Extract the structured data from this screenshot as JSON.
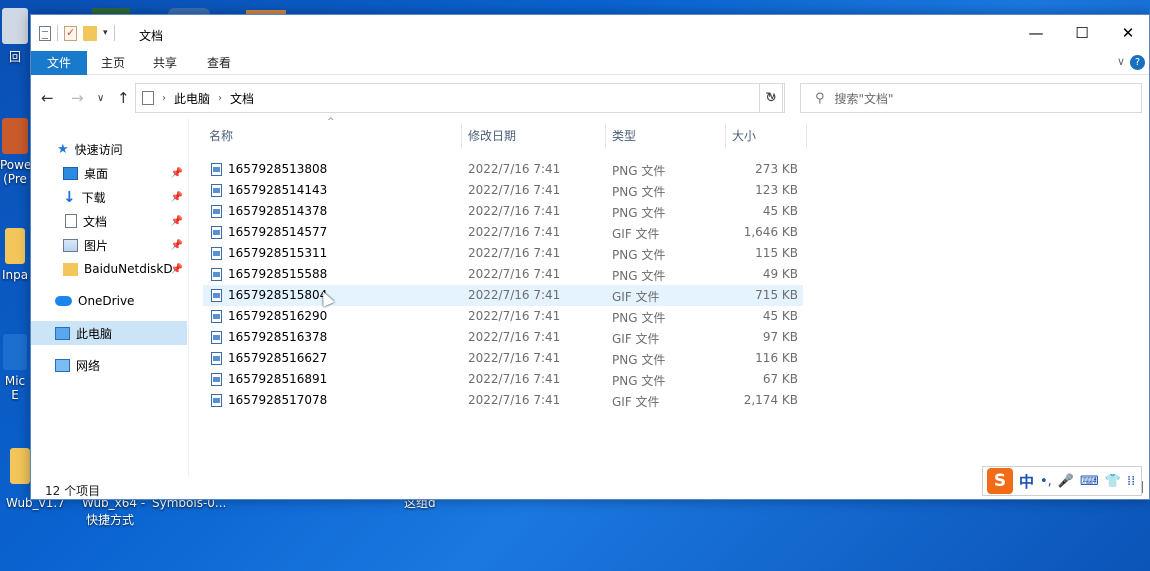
{
  "window": {
    "title": "文档",
    "minimize": "—",
    "maximize": "☐",
    "close": "✕"
  },
  "ribbon": {
    "tabs": [
      "文件",
      "主页",
      "共享",
      "查看"
    ],
    "chevron": "∨",
    "help": "?"
  },
  "nav": {
    "back": "←",
    "forward": "→",
    "recent": "∨",
    "up": "↑",
    "breadcrumb": [
      "此电脑",
      "文档"
    ],
    "breadcrumb_sep": "›",
    "refresh": "↻",
    "search_placeholder": "搜索\"文档\""
  },
  "sidebar": {
    "items": [
      {
        "label": "快速访问",
        "icon": "star-icon"
      },
      {
        "label": "桌面",
        "icon": "desktop-icon",
        "pinned": true
      },
      {
        "label": "下载",
        "icon": "download-icon",
        "pinned": true
      },
      {
        "label": "文档",
        "icon": "document-icon",
        "pinned": true
      },
      {
        "label": "图片",
        "icon": "pictures-icon",
        "pinned": true
      },
      {
        "label": "BaiduNetdiskD",
        "icon": "folder-icon",
        "pinned": true
      },
      {
        "label": "OneDrive",
        "icon": "cloud-icon"
      },
      {
        "label": "此电脑",
        "icon": "computer-icon",
        "selected": true
      },
      {
        "label": "网络",
        "icon": "network-icon"
      }
    ]
  },
  "columns": {
    "name": "名称",
    "date": "修改日期",
    "type": "类型",
    "size": "大小"
  },
  "files": [
    {
      "name": "1657928513808",
      "date": "2022/7/16 7:41",
      "type": "PNG 文件",
      "size": "273 KB"
    },
    {
      "name": "1657928514143",
      "date": "2022/7/16 7:41",
      "type": "PNG 文件",
      "size": "123 KB"
    },
    {
      "name": "1657928514378",
      "date": "2022/7/16 7:41",
      "type": "PNG 文件",
      "size": "45 KB"
    },
    {
      "name": "1657928514577",
      "date": "2022/7/16 7:41",
      "type": "GIF 文件",
      "size": "1,646 KB"
    },
    {
      "name": "1657928515311",
      "date": "2022/7/16 7:41",
      "type": "PNG 文件",
      "size": "115 KB"
    },
    {
      "name": "1657928515588",
      "date": "2022/7/16 7:41",
      "type": "PNG 文件",
      "size": "49 KB"
    },
    {
      "name": "1657928515804",
      "date": "2022/7/16 7:41",
      "type": "GIF 文件",
      "size": "715 KB",
      "hover": true
    },
    {
      "name": "1657928516290",
      "date": "2022/7/16 7:41",
      "type": "PNG 文件",
      "size": "45 KB"
    },
    {
      "name": "1657928516378",
      "date": "2022/7/16 7:41",
      "type": "GIF 文件",
      "size": "97 KB"
    },
    {
      "name": "1657928516627",
      "date": "2022/7/16 7:41",
      "type": "PNG 文件",
      "size": "116 KB"
    },
    {
      "name": "1657928516891",
      "date": "2022/7/16 7:41",
      "type": "PNG 文件",
      "size": "67 KB"
    },
    {
      "name": "1657928517078",
      "date": "2022/7/16 7:41",
      "type": "GIF 文件",
      "size": "2,174 KB"
    }
  ],
  "status": {
    "count": "12 个项目"
  },
  "ime": {
    "logo": "S",
    "lang": "中",
    "punct": "•,",
    "mic": "🎤",
    "keyboard": "⌨",
    "skin": "👕",
    "grid": "⁞⁞"
  },
  "desktop": {
    "labels": [
      "回",
      "Powe",
      "(Pre",
      "Inpa",
      "Mic",
      "E",
      "Wub_v1.7",
      "Wub_x64 -",
      "快捷方式",
      "Symbols-0...",
      "这组d"
    ]
  },
  "colors": {
    "accent": "#1979ca",
    "selection": "#cce4f7",
    "hover": "#e5f3ff",
    "header_text": "#4c607a"
  }
}
